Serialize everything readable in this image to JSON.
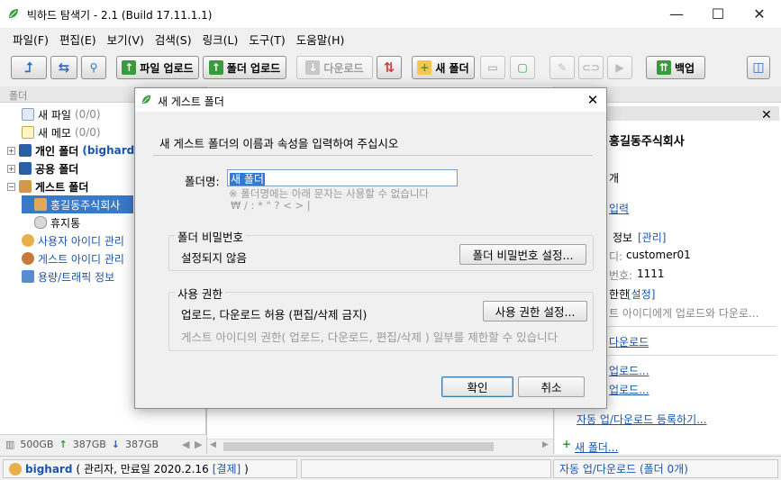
{
  "window": {
    "title": "빅하드 탐색기 - 2.1 (Build 17.11.1.1)",
    "minimize_glyph": "—",
    "maximize_glyph": "☐",
    "close_glyph": "✕"
  },
  "menu": [
    "파일(F)",
    "편집(E)",
    "보기(V)",
    "검색(S)",
    "링크(L)",
    "도구(T)",
    "도움말(H)"
  ],
  "toolbar": {
    "upload_file": "파일 업로드",
    "upload_folder": "폴더 업로드",
    "download": "다운로드",
    "new_folder": "새 폴더",
    "backup": "백업"
  },
  "left_panel": {
    "header": "폴더",
    "tree": [
      {
        "label": "새 파일",
        "count": "(0/0)"
      },
      {
        "label": "새 메모",
        "count": "(0/0)"
      },
      {
        "label": "개인 폴더",
        "suffix": "(bighard"
      },
      {
        "label": "공용 폴더"
      },
      {
        "label": "게스트 폴더"
      },
      {
        "label": "홍길동주식회사"
      },
      {
        "label": "휴지통"
      },
      {
        "label": "사용자 아이디 관리"
      },
      {
        "label": "게스트 아이디 관리"
      },
      {
        "label": "용량/트래픽 정보"
      }
    ],
    "storage_total": "500GB",
    "storage_up": "387GB",
    "storage_down": "387GB"
  },
  "right_panel": {
    "company": "홍길동주식회사",
    "count_suffix": "개",
    "link_input": "입력",
    "info_label": "정보",
    "manage_link": "[관리]",
    "id_label": "디:",
    "id_value": "customer01",
    "pw_label": "번호:",
    "pw_value": "1111",
    "perm_label": "한한",
    "perm_link": "[설정]",
    "perm_desc": "트 아이디에게 업로드와 다운로...",
    "download_link": "다운로드",
    "link_a": "업로드...",
    "link_b": "업로드...",
    "auto_register": "자동 업/다운로드 등록하기...",
    "new_folder": "새 폴더..."
  },
  "statusbar": {
    "user": "bighard",
    "user_info": "( 관리자, 만료일 2020.2.16",
    "pay_link": "[결제]",
    "close_paren": ")",
    "auto_status": "자동 업/다운로드 (폴더 0개)"
  },
  "dialog": {
    "title": "새 게스트 폴더",
    "description": "새 게스트 폴더의 이름과 속성을 입력하여 주십시오",
    "folder_name_label": "폴더명:",
    "folder_name_value": "새 폴더",
    "hint_line1": "※ 폴더명에는 아래 문자는 사용할 수 없습니다",
    "hint_line2": "₩ / : * \" ? < > |",
    "password_group": "폴더 비밀번호",
    "password_status": "설정되지 않음",
    "password_button": "폴더 비밀번호 설정...",
    "permission_group": "사용 권한",
    "permission_status": "업로드, 다운로드 허용 (편집/삭제 금지)",
    "permission_button": "사용 권한 설정...",
    "permission_hint": "게스트 아이디의 권한( 업로드, 다운로드, 편집/삭제 ) 일부를 제한할 수 있습니다",
    "ok": "확인",
    "cancel": "취소"
  },
  "colors": {
    "accent": "#3379d1",
    "link": "#1a55b0",
    "green_icon": "#3a9b3a"
  }
}
